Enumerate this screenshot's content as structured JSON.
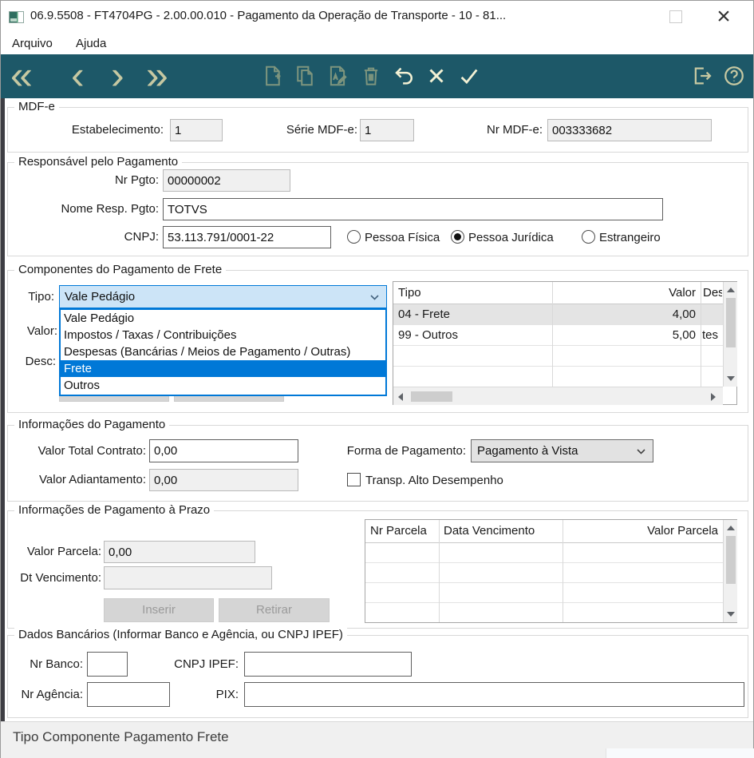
{
  "window": {
    "title": "06.9.5508 - FT4704PG - 2.00.00.010 - Pagamento da Operação de Transporte - 10 - 81...",
    "controls": {
      "close": "×"
    }
  },
  "menu": {
    "arquivo": "Arquivo",
    "ajuda": "Ajuda"
  },
  "toolbar": {
    "nav": {
      "first": "«",
      "prev": "‹",
      "next": "›",
      "last": "»"
    },
    "icons": [
      "first-record",
      "prev-record",
      "next-record",
      "last-record",
      "new",
      "copy",
      "edit",
      "delete",
      "undo",
      "cancel",
      "confirm",
      "exit",
      "help"
    ]
  },
  "mdfe": {
    "title": "MDF-e",
    "estabelecimento": {
      "label": "Estabelecimento:",
      "value": "1"
    },
    "serie": {
      "label": "Série MDF-e:",
      "value": "1"
    },
    "numero": {
      "label": "Nr MDF-e:",
      "value": "003333682"
    }
  },
  "responsavel": {
    "title": "Responsável pelo Pagamento",
    "nr_pgto": {
      "label": "Nr Pgto:",
      "value": "00000002"
    },
    "nome": {
      "label": "Nome Resp. Pgto:",
      "value": "TOTVS"
    },
    "cnpj": {
      "label": "CNPJ:",
      "value": "53.113.791/0001-22"
    },
    "radios": {
      "pessoa_fisica": "Pessoa Física",
      "pessoa_juridica": "Pessoa Jurídica",
      "estrangeiro": "Estrangeiro",
      "selected": "Pessoa Jurídica"
    }
  },
  "components": {
    "title": "Componentes do Pagamento de Frete",
    "tipo_label": "Tipo:",
    "valor_label": "Valor:",
    "desc_label": "Desc:",
    "combo": {
      "value": "Vale Pedágio",
      "options": [
        "Vale Pedágio",
        "Impostos / Taxas / Contribuições",
        "Despesas (Bancárias / Meios de Pagamento / Outras)",
        "Frete",
        "Outros"
      ],
      "highlighted": "Frete"
    },
    "table": {
      "headers": [
        "Tipo",
        "Valor",
        "Des"
      ],
      "rows": [
        {
          "tipo": "04 - Frete",
          "valor": "4,00",
          "des": ""
        },
        {
          "tipo": "99 - Outros",
          "valor": "5,00",
          "des": "tes"
        }
      ]
    }
  },
  "info_pagamento": {
    "title": "Informações do Pagamento",
    "valor_total": {
      "label": "Valor Total Contrato:",
      "value": "0,00"
    },
    "forma": {
      "label": "Forma de Pagamento:",
      "value": "Pagamento à Vista"
    },
    "valor_adiantamento": {
      "label": "Valor Adiantamento:",
      "value": "0,00"
    },
    "transp_alto": {
      "label": "Transp. Alto Desempenho",
      "checked": false
    }
  },
  "prazo": {
    "title": "Informações de Pagamento à Prazo",
    "valor_parcela": {
      "label": "Valor Parcela:",
      "value": "0,00"
    },
    "dt_vencimento": {
      "label": "Dt Vencimento:",
      "value": ""
    },
    "inserir": "Inserir",
    "retirar": "Retirar",
    "table": {
      "headers": [
        "Nr Parcela",
        "Data Vencimento",
        "Valor Parcela"
      ]
    }
  },
  "bancarios": {
    "title": "Dados Bancários (Informar Banco e Agência, ou CNPJ IPEF)",
    "nr_banco": {
      "label": "Nr Banco:",
      "value": ""
    },
    "cnpj_ipef": {
      "label": "CNPJ IPEF:",
      "value": ""
    },
    "nr_agencia": {
      "label": "Nr Agência:",
      "value": ""
    },
    "pix": {
      "label": "PIX:",
      "value": ""
    }
  },
  "statusbar": {
    "text": "Tipo Componente Pagamento Frete"
  },
  "colors": {
    "toolbar_bg": "#1d5868",
    "accent": "#0078d7",
    "combo_focus_bg": "#cce4f7",
    "icon_bright": "#f3f1d4",
    "icon_dim": "#c6c8a2",
    "icon_disabled": "#7e957e",
    "selected_row_bg": "#e4e4e4"
  }
}
